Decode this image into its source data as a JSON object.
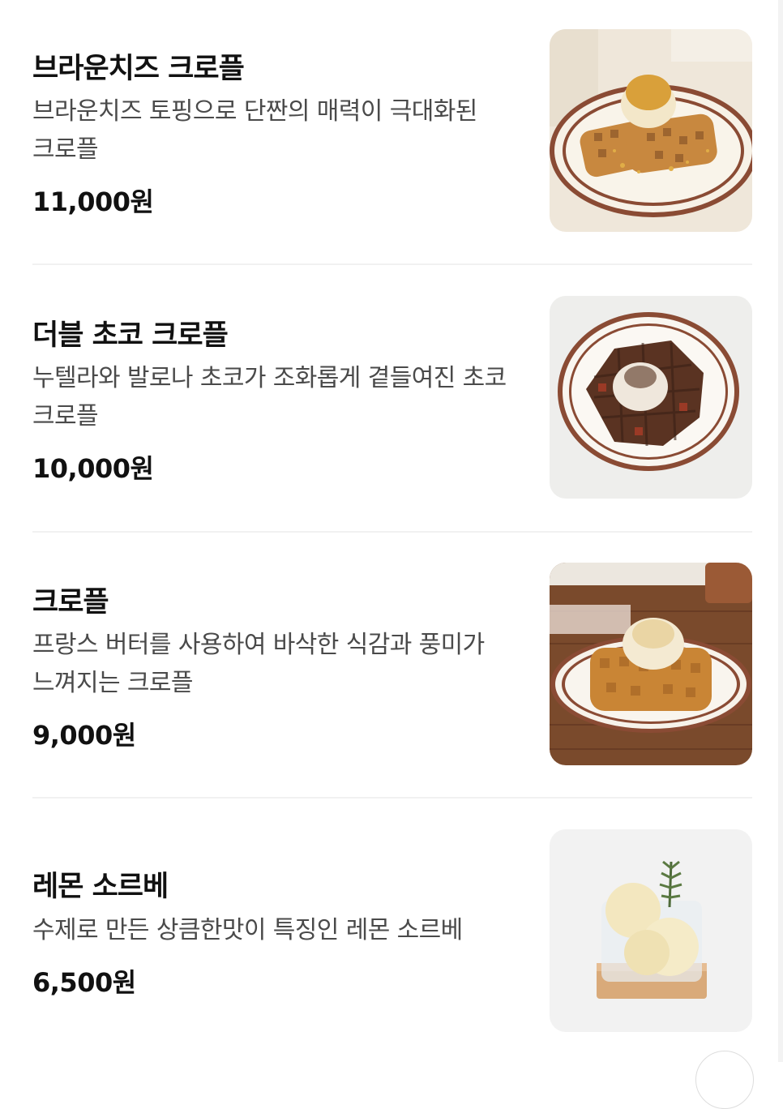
{
  "menu": {
    "items": [
      {
        "name": "브라운치즈 크로플",
        "description": "브라운치즈 토핑으로 단짠의 매력이 극대화된 크로플",
        "price": "11,000원",
        "image": "brown-cheese-croffle-photo"
      },
      {
        "name": "더블 초코 크로플",
        "description": "누텔라와 발로나 초코가 조화롭게 곁들여진 초코 크로플",
        "price": "10,000원",
        "image": "double-choco-croffle-photo"
      },
      {
        "name": "크로플",
        "description": "프랑스 버터를 사용하여 바삭한 식감과 풍미가 느껴지는 크로플",
        "price": "9,000원",
        "image": "croffle-photo"
      },
      {
        "name": "레몬 소르베",
        "description": "수제로 만든 상큼한맛이 특징인 레몬 소르베",
        "price": "6,500원",
        "image": "lemon-sorbet-photo"
      }
    ]
  },
  "colors": {
    "text_primary": "#111111",
    "text_secondary": "#4a4a4a",
    "divider": "#f1f1f1",
    "background": "#ffffff"
  }
}
